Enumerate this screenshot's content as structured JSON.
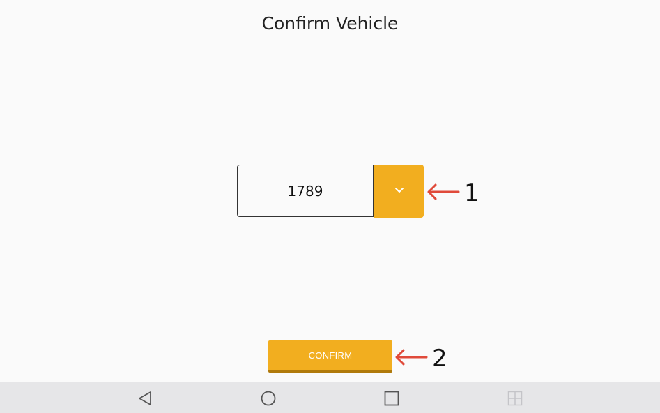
{
  "header": {
    "title": "Confirm Vehicle"
  },
  "vehicle_select": {
    "value": "1789",
    "dropdown_icon": "chevron-down-icon"
  },
  "actions": {
    "confirm_label": "CONFIRM"
  },
  "annotations": {
    "marker_1": "1",
    "marker_2": "2"
  },
  "navbar": {
    "icons": [
      "back-icon",
      "home-icon",
      "recents-icon",
      "split-screen-icon"
    ]
  },
  "colors": {
    "accent": "#f2ae1f",
    "accent_shadow": "#b07a0c",
    "annotation_arrow": "#e04a3a",
    "background": "#fafafa",
    "navbar": "#e6e6e8"
  }
}
